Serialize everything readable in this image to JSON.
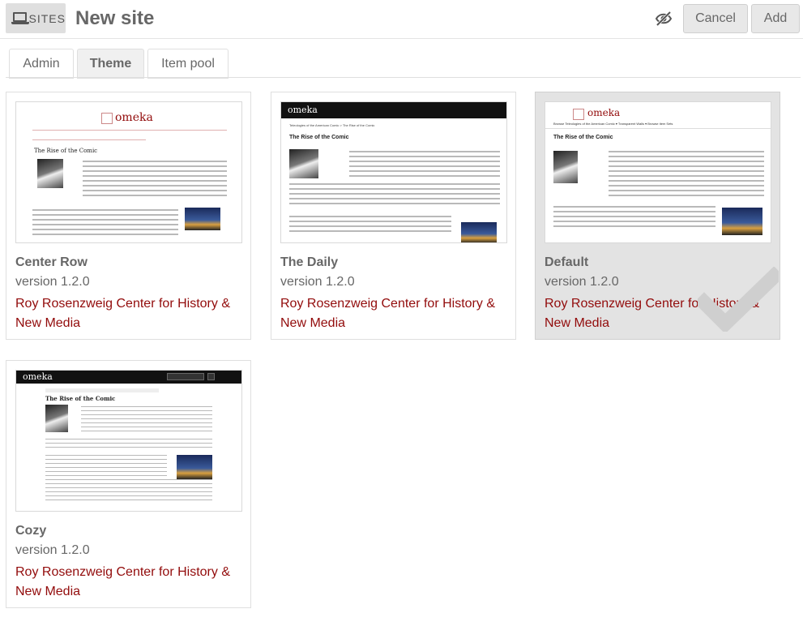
{
  "header": {
    "section_label": "SITES",
    "section_icon": "laptop-icon",
    "title": "New site",
    "visibility_icon": "eye-slash-icon",
    "cancel_label": "Cancel",
    "add_label": "Add"
  },
  "tabs": [
    {
      "label": "Admin",
      "active": false
    },
    {
      "label": "Theme",
      "active": true
    },
    {
      "label": "Item pool",
      "active": false
    }
  ],
  "themes": [
    {
      "name": "Center Row",
      "version": "version 1.2.0",
      "author": "Roy Rosenzweig Center for History & New Media",
      "selected": false,
      "preview": {
        "logo": "omeka",
        "page_title": "The Rise of the Comic"
      }
    },
    {
      "name": "The Daily",
      "version": "version 1.2.0",
      "author": "Roy Rosenzweig Center for History & New Media",
      "selected": false,
      "preview": {
        "logo": "omeka",
        "breadcrumb": "Teleologies of the American Comic  >  The Rise of the Comic",
        "page_title": "The Rise of the Comic"
      }
    },
    {
      "name": "Default",
      "version": "version 1.2.0",
      "author": "Roy Rosenzweig Center for History & New Media",
      "selected": true,
      "preview": {
        "logo": "omeka",
        "nav": "Browse   Teleologies of the American Comic ▾   Transparent Walls ▾   Browse item Sets",
        "page_title": "The Rise of the Comic"
      }
    },
    {
      "name": "Cozy",
      "version": "version 1.2.0",
      "author": "Roy Rosenzweig Center for History & New Media",
      "selected": false,
      "preview": {
        "logo": "omeka",
        "page_title": "The Rise of the Comic"
      }
    }
  ],
  "colors": {
    "accent": "#920b0b",
    "text": "#676767",
    "selected_bg": "#e3e3e3"
  },
  "selected_icon": "checkmark-icon"
}
